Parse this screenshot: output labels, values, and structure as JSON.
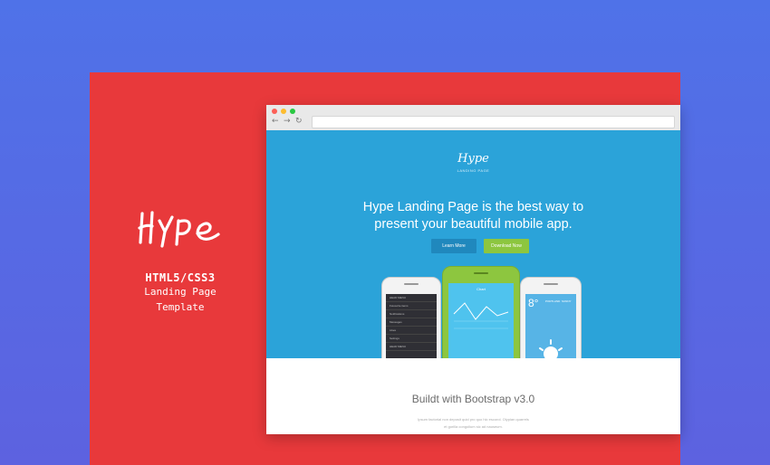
{
  "brand": {
    "line1": "HTML5/CSS3",
    "line2": "Landing Page",
    "line3": "Template"
  },
  "browser": {
    "nav_back": "←",
    "nav_forward": "→",
    "nav_reload": "↻"
  },
  "hero": {
    "logo": "Hype",
    "logo_sub": "LANDING PAGE",
    "headline_line1": "Hype Landing Page is the best way to",
    "headline_line2": "present your beautiful mobile app.",
    "learn_label": "Learn More",
    "download_label": "Download Now"
  },
  "phones": {
    "left_menu": [
      "HEAD MENU",
      "Favourite items",
      "Notifications",
      "Messages",
      "Likes",
      "Settings",
      "HEAD MENU"
    ],
    "center_header": "Chart",
    "right_temp": "8°",
    "right_city": "PORTLAND",
    "right_cond": "SUNNY"
  },
  "lower": {
    "title": "Buildt with Bootstrap v3.0",
    "desc_line1": "Ipsum factorial non deposit quid pro quo hic escorol. Olypian quarrels",
    "desc_line2": "et gorilla congolium sic ad nauseum."
  },
  "colors": {
    "background": "#5068e6",
    "card": "#e8393b",
    "hero": "#2ba3d9",
    "learn_button": "#2088bd",
    "download_button": "#8dc63f"
  }
}
